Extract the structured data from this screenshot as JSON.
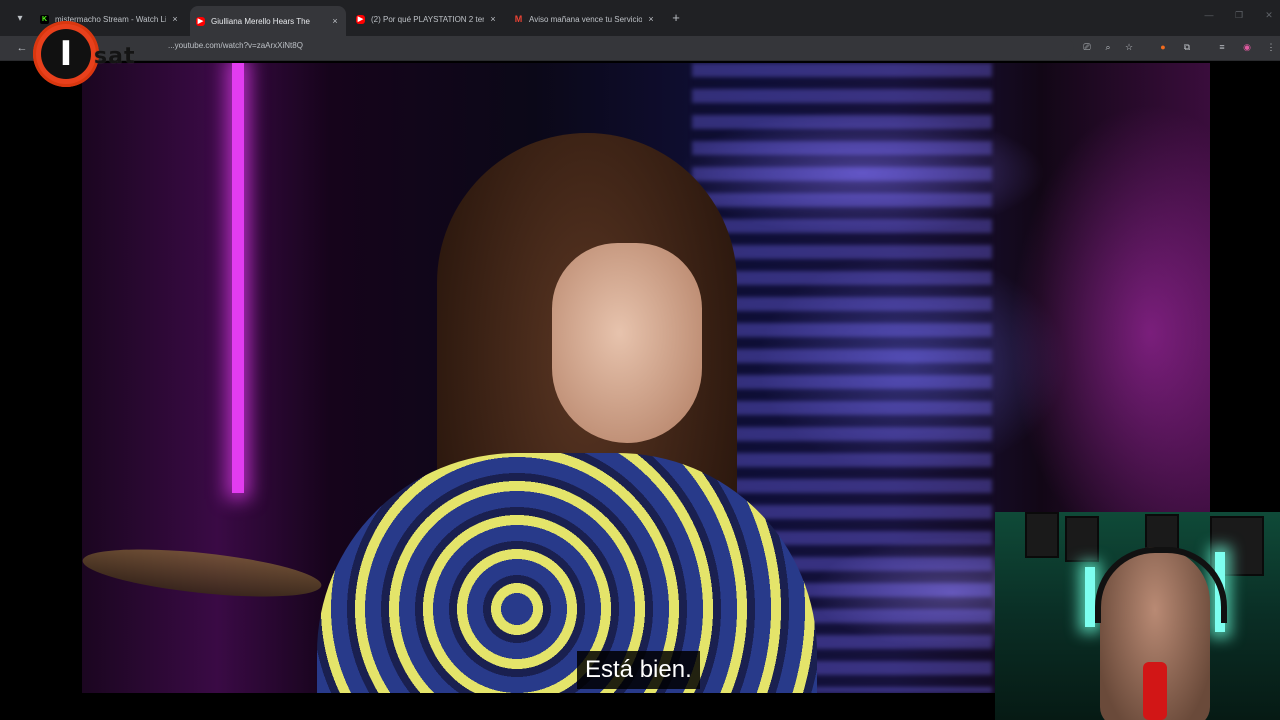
{
  "browser": {
    "tabs": [
      {
        "title": "mistermacho Stream - Watch Li",
        "favicon": "kick-icon",
        "active": false
      },
      {
        "title": "Giulliana Merello Hears The",
        "favicon": "youtube-icon",
        "active": true
      },
      {
        "title": "(2) Por qué PLAYSTATION 2 ten",
        "favicon": "youtube-icon",
        "active": false
      },
      {
        "title": "Aviso mañana vence tu Servicio",
        "favicon": "gmail-icon",
        "active": false
      }
    ],
    "tab_close_glyph": "×",
    "new_tab_glyph": "+",
    "url": "...youtube.com/watch?v=zaArxXiNt8Q"
  },
  "logo": {
    "letter": "I",
    "word": "sat"
  },
  "video": {
    "subtitle": "Está bien."
  },
  "colors": {
    "chrome_bg": "#202124",
    "toolbar_bg": "#35363a",
    "logo_accent": "#e8401c",
    "neon": "#e23cf0"
  }
}
